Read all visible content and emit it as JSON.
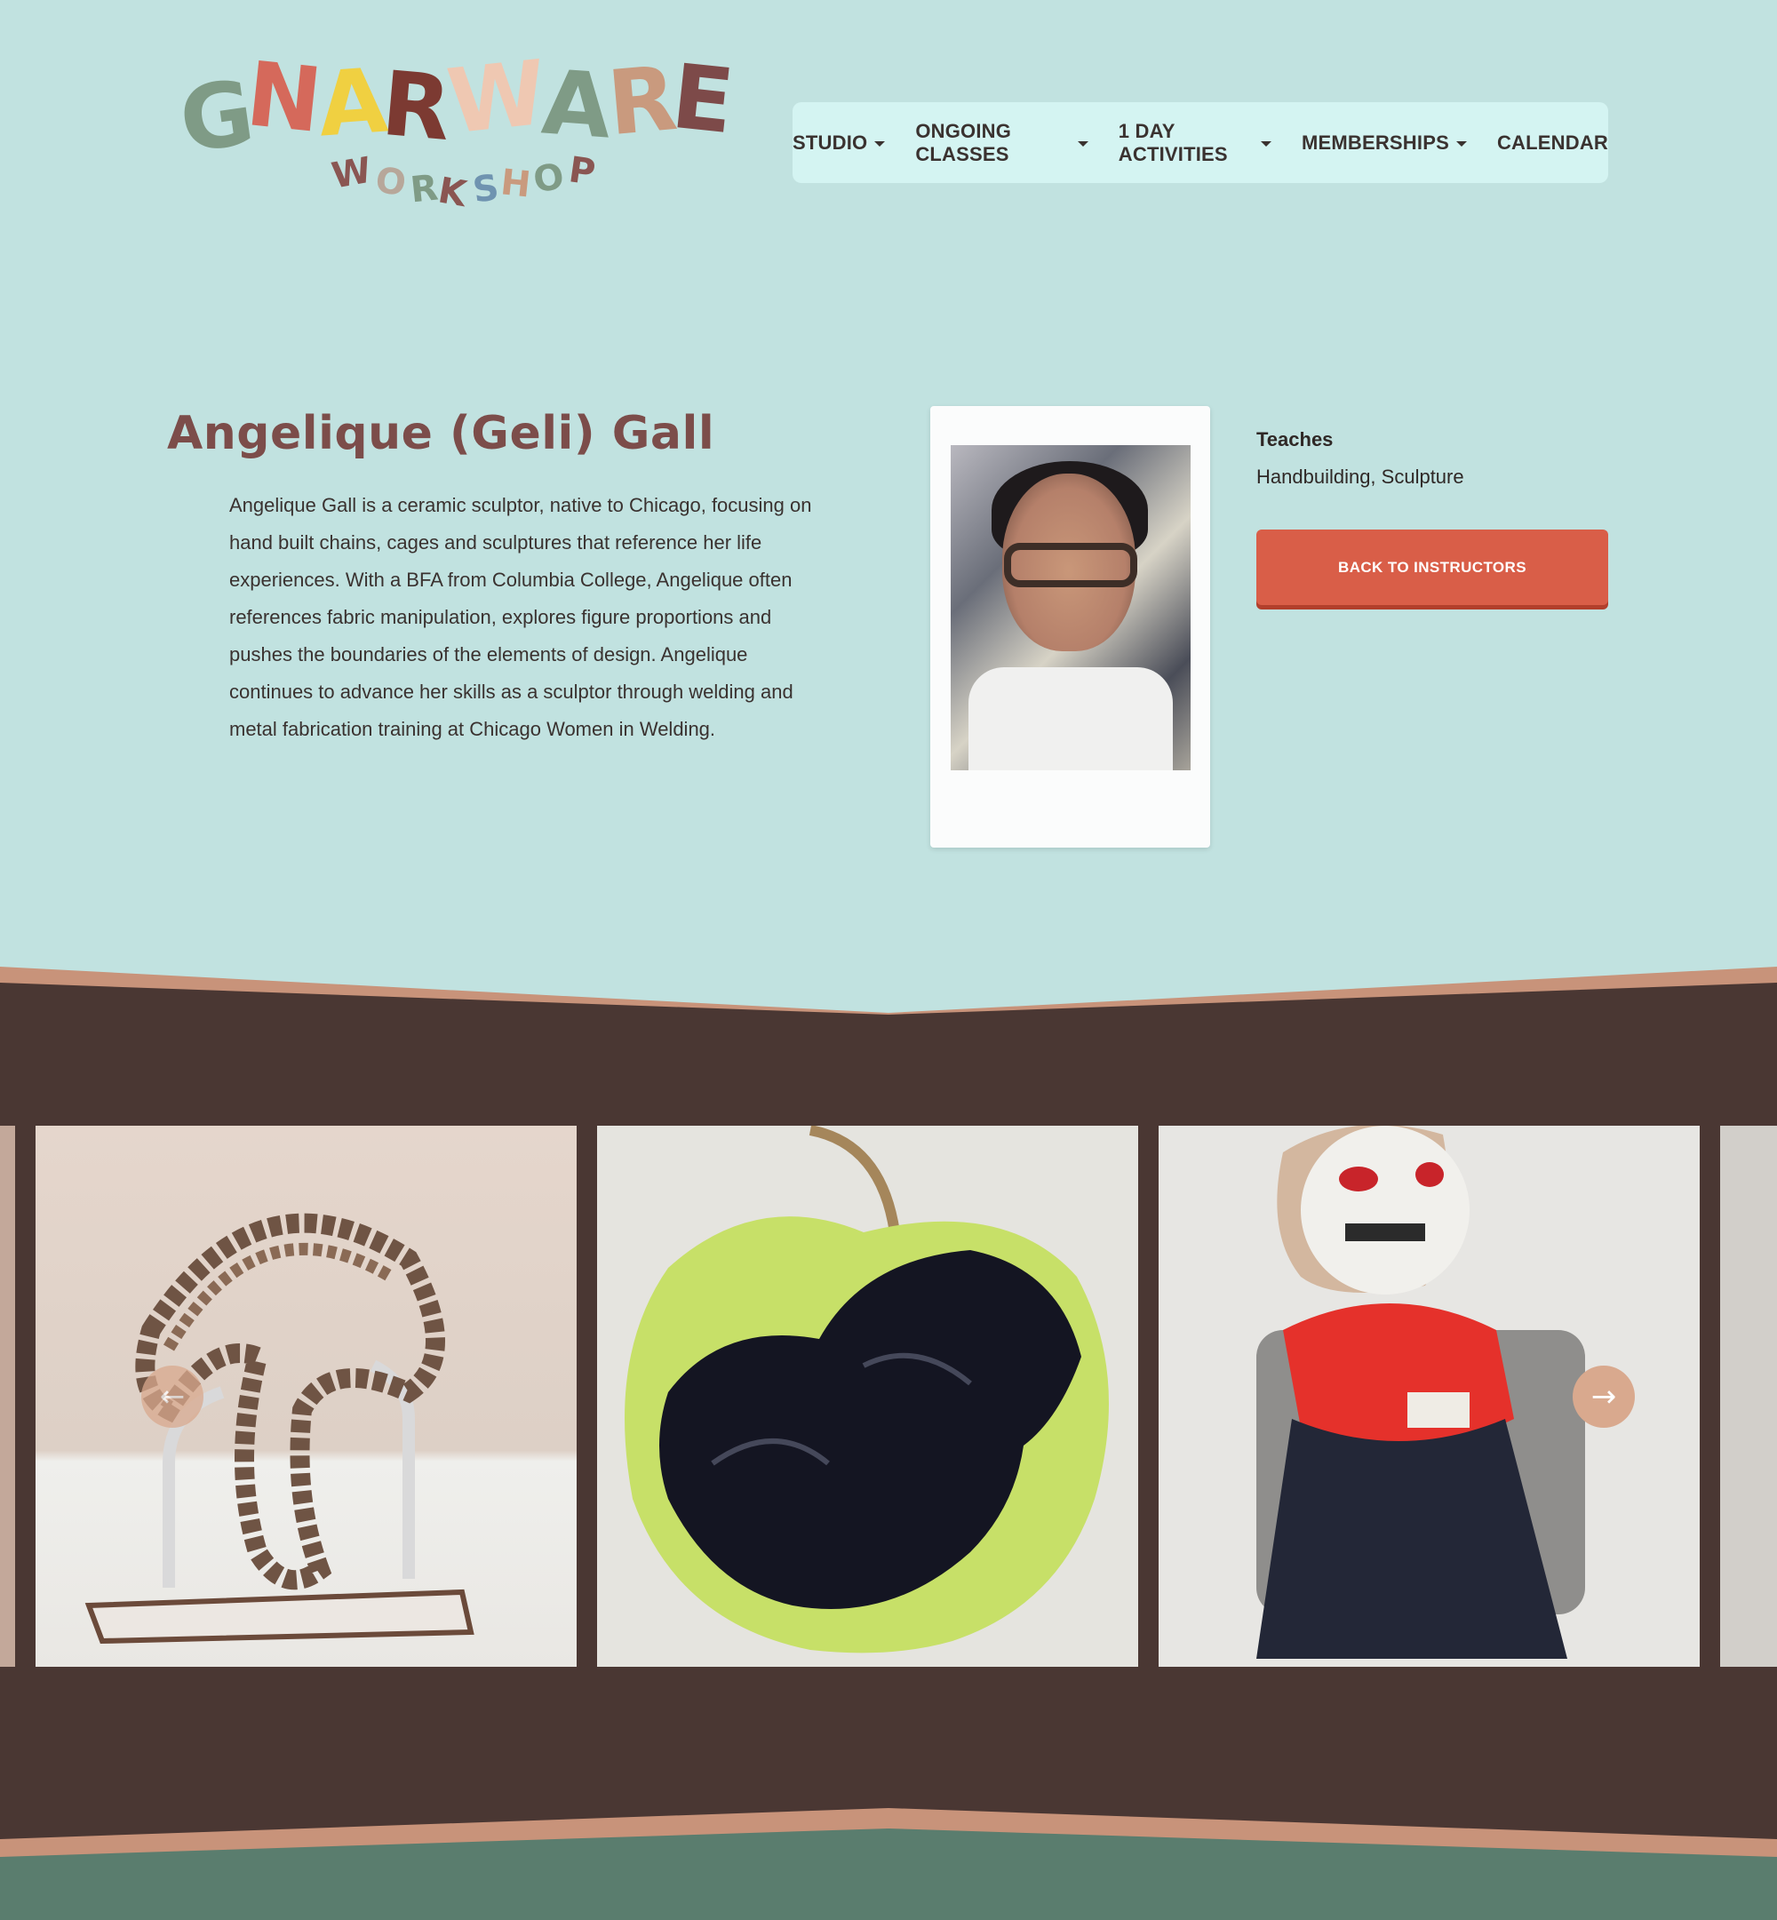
{
  "brand": {
    "logo_main": "GNARWARE",
    "logo_sub": "WORKSHOP",
    "logo_main_colors": [
      "#7f9b86",
      "#d5695b",
      "#f0d041",
      "#7c3a32",
      "#efc8b2",
      "#7f9b86",
      "#c99a7e",
      "#7d4a49"
    ],
    "logo_sub_colors": [
      "#8a5652",
      "#b7a79a",
      "#7f9b86",
      "#8a5652",
      "#6f93b0",
      "#c99a7e",
      "#7f9b86",
      "#8a5652"
    ]
  },
  "nav": {
    "items": [
      {
        "label": "STUDIO",
        "has_dropdown": true
      },
      {
        "label": "ONGOING CLASSES",
        "has_dropdown": true
      },
      {
        "label": "1 DAY ACTIVITIES",
        "has_dropdown": true
      },
      {
        "label": "MEMBERSHIPS",
        "has_dropdown": true
      },
      {
        "label": "CALENDAR",
        "has_dropdown": false
      }
    ]
  },
  "instructor": {
    "name": "Angelique (Geli) Gall",
    "bio": "Angelique Gall is a ceramic sculptor, native to Chicago, focusing on hand built chains, cages and sculptures that reference her life experiences. With a BFA from Columbia College, Angelique often references fabric manipulation, explores figure proportions and pushes the boundaries of the elements of design. Angelique continues to advance her skills as a sculptor through welding and metal fabrication training at Chicago Women in Welding.",
    "teaches_heading": "Teaches",
    "teaches_value": "Handbuilding, Sculpture",
    "back_button": "BACK TO INSTRUCTORS"
  },
  "gallery": {
    "prev_icon": "←",
    "next_icon": "→",
    "slides": [
      "chain-sculpture",
      "apple-sculpture",
      "skeleton-figure-sculpture"
    ]
  },
  "colors": {
    "page_bg": "#c1e2e0",
    "band_bg": "#4a3733",
    "band_trim": "#c8937a",
    "footer_bg": "#5a7d6e",
    "accent_button": "#d95e48",
    "heading": "#7c4d4a"
  }
}
